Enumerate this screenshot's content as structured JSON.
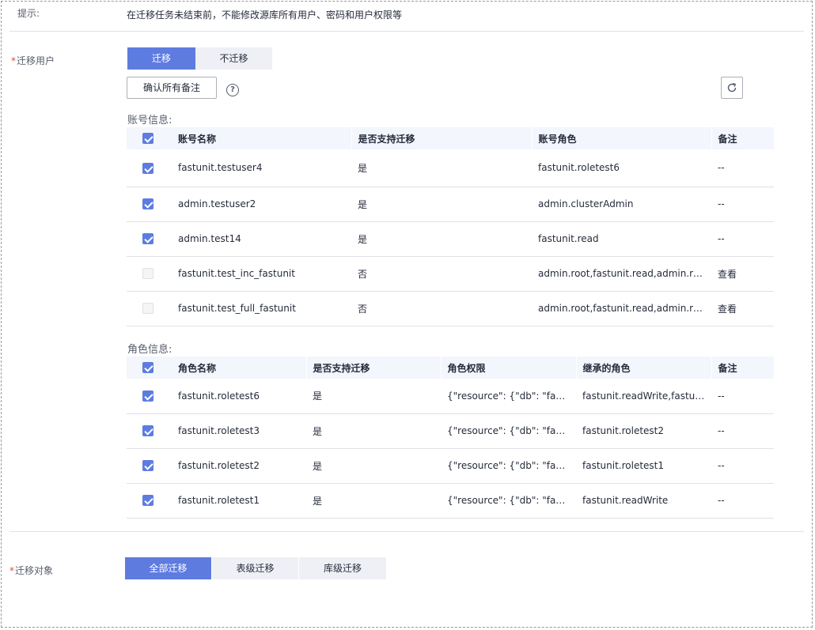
{
  "hint": {
    "label": "提示:",
    "text": "在迁移任务未结束前，不能修改源库所有用户、密码和用户权限等"
  },
  "migrate_users": {
    "label": "迁移用户",
    "options": [
      {
        "label": "迁移",
        "active": true
      },
      {
        "label": "不迁移",
        "active": false
      }
    ],
    "confirm_button": "确认所有备注",
    "help_icon": "question-circle-icon",
    "refresh_icon": "refresh-icon"
  },
  "accounts": {
    "title": "账号信息:",
    "columns": [
      "账号名称",
      "是否支持迁移",
      "账号角色",
      "备注"
    ],
    "rows": [
      {
        "checked": true,
        "enabled": true,
        "name": "fastunit.testuser4",
        "support": "是",
        "role": "fastunit.roletest6",
        "note": "--"
      },
      {
        "checked": true,
        "enabled": true,
        "name": "admin.testuser2",
        "support": "是",
        "role": "admin.clusterAdmin",
        "note": "--"
      },
      {
        "checked": true,
        "enabled": true,
        "name": "admin.test14",
        "support": "是",
        "role": "fastunit.read",
        "note": "--"
      },
      {
        "checked": false,
        "enabled": false,
        "name": "fastunit.test_inc_fastunit",
        "support": "否",
        "role": "admin.root,fastunit.read,admin.read...",
        "note": "查看"
      },
      {
        "checked": false,
        "enabled": false,
        "name": "fastunit.test_full_fastunit",
        "support": "否",
        "role": "admin.root,fastunit.read,admin.read...",
        "note": "查看"
      }
    ]
  },
  "roles": {
    "title": "角色信息:",
    "columns": [
      "角色名称",
      "是否支持迁移",
      "角色权限",
      "继承的角色",
      "备注"
    ],
    "rows": [
      {
        "checked": true,
        "name": "fastunit.roletest6",
        "support": "是",
        "privileges": "{\"resource\": {\"db\": \"fastu...",
        "inherited": "fastunit.readWrite,fastuni...",
        "note": "--"
      },
      {
        "checked": true,
        "name": "fastunit.roletest3",
        "support": "是",
        "privileges": "{\"resource\": {\"db\": \"fastu...",
        "inherited": "fastunit.roletest2",
        "note": "--"
      },
      {
        "checked": true,
        "name": "fastunit.roletest2",
        "support": "是",
        "privileges": "{\"resource\": {\"db\": \"fastu...",
        "inherited": "fastunit.roletest1",
        "note": "--"
      },
      {
        "checked": true,
        "name": "fastunit.roletest1",
        "support": "是",
        "privileges": "{\"resource\": {\"db\": \"fastu...",
        "inherited": "fastunit.readWrite",
        "note": "--"
      }
    ]
  },
  "migrate_objects": {
    "label": "迁移对象",
    "options": [
      {
        "label": "全部迁移",
        "active": true
      },
      {
        "label": "表级迁移",
        "active": false
      },
      {
        "label": "库级迁移",
        "active": false
      }
    ]
  },
  "colors": {
    "accent": "#5e7ce0",
    "danger": "#e54545",
    "header_bg": "#f3f6fc"
  }
}
